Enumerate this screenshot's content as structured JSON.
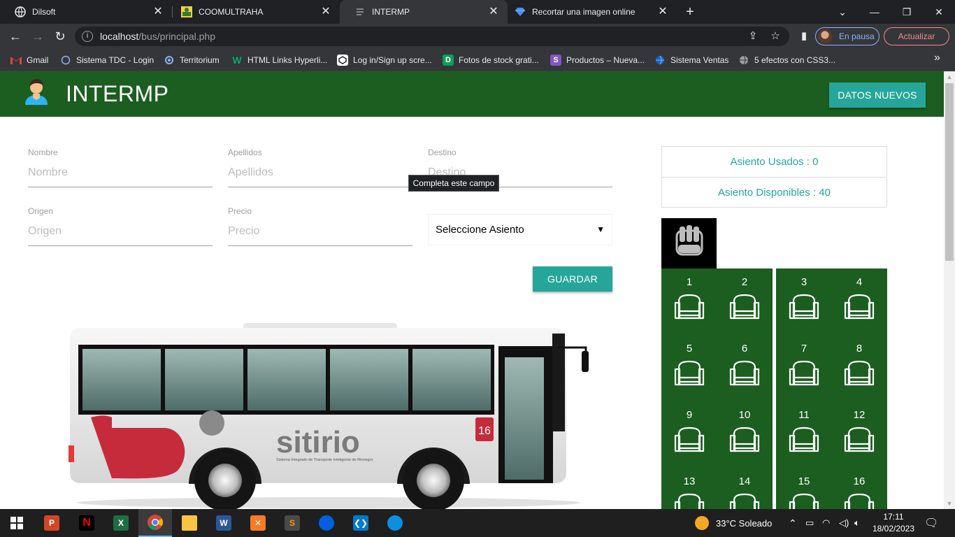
{
  "browser": {
    "tabs": [
      {
        "title": "Dilsoft",
        "icon": "globe-icon"
      },
      {
        "title": "COOMULTRAHA",
        "icon": "coomultraha-icon"
      },
      {
        "title": "INTERMP",
        "icon": "page-icon"
      },
      {
        "title": "Recortar una imagen online",
        "icon": "diamond-icon"
      }
    ],
    "url_host": "localhost",
    "url_path": "/bus/principal.php",
    "profile_status": "En pausa",
    "update_label": "Actualizar",
    "bookmarks": [
      {
        "label": "Gmail",
        "icon": "gmail-icon"
      },
      {
        "label": "Sistema TDC - Login",
        "icon": "circle-icon"
      },
      {
        "label": "Territorium",
        "icon": "territorium-icon"
      },
      {
        "label": "HTML Links Hyperli...",
        "icon": "w3-icon"
      },
      {
        "label": "Log in/Sign up scre...",
        "icon": "codepen-icon"
      },
      {
        "label": "Fotos de stock grati...",
        "icon": "d-icon"
      },
      {
        "label": "Productos – Nueva...",
        "icon": "s-icon"
      },
      {
        "label": "Sistema Ventas",
        "icon": "globe-icon"
      },
      {
        "label": "5 efectos con CSS3...",
        "icon": "globe-icon"
      }
    ]
  },
  "app": {
    "title": "INTERMP",
    "new_button": "DATOS NUEVOS",
    "form": {
      "nombre_label": "Nombre",
      "nombre_placeholder": "Nombre",
      "apellidos_label": "Apellidos",
      "apellidos_placeholder": "Apellidos",
      "destino_label": "Destino",
      "destino_placeholder": "Destino",
      "origen_label": "Origen",
      "origen_placeholder": "Origen",
      "precio_label": "Precio",
      "precio_placeholder": "Precio",
      "seat_select": "Seleccione Asiento",
      "save_button": "GUARDAR",
      "tooltip": "Completa este campo"
    },
    "stats": {
      "used": "Asiento Usados : 0",
      "available": "Asiento Disponibles : 40"
    },
    "seats": [
      "1",
      "2",
      "3",
      "4",
      "5",
      "6",
      "7",
      "8",
      "9",
      "10",
      "11",
      "12",
      "13",
      "14",
      "15",
      "16"
    ],
    "bus": {
      "brand": "sitirio",
      "tagline": "Sistema Integrado de Transporte Inteligente de Rionegro",
      "number": "16"
    }
  },
  "taskbar": {
    "weather": "33°C  Soleado",
    "time": "17:11",
    "date": "18/02/2023"
  },
  "colors": {
    "header_green": "#1b5e20",
    "teal": "#26a69a"
  }
}
